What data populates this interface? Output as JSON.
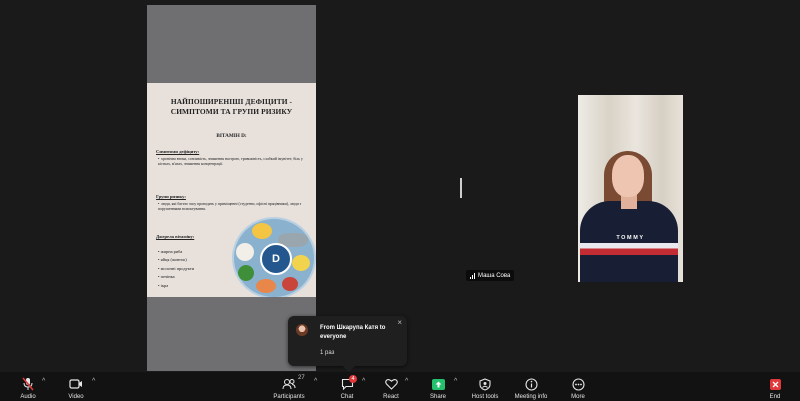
{
  "slide": {
    "title": "НАЙПОШИРЕНІШІ ДЕФІЦИТИ - СИМПТОМИ ТА ГРУПИ РИЗИКУ",
    "subtitle": "ВІТАМІН D:",
    "symptoms_heading": "Симптоми дефіциту:",
    "symptoms_text": "хронічна втома, сонливість, зниження настрою, тривожність, слабкий імунітет, біль у кістках, м'язах, зниження концентрації.",
    "risk_heading": "Групи ризику:",
    "risk_text": "люди, які багато часу проводять у приміщенні (студенти, офісні працівники), люди з порушеннями всмоктування.",
    "sources_heading": "Джерела вітаміну:",
    "sources": [
      "жирна риба",
      "яйця (жовток)",
      "молочні продукти",
      "печінка",
      "ікра"
    ],
    "plate_letter": "D"
  },
  "camera": {
    "participant_name": "Маша Сова",
    "shirt_text": "TOMMY"
  },
  "chat_toast": {
    "title": "From Шкарупа Катя to everyone",
    "message": "1 раз",
    "close": "×"
  },
  "toolbar": {
    "audio": "Audio",
    "video": "Video",
    "participants": "Participants",
    "participants_count": "27",
    "chat": "Chat",
    "chat_badge": "4",
    "react": "React",
    "share": "Share",
    "host_tools": "Host tools",
    "meeting_info": "Meeting info",
    "more": "More",
    "end": "End",
    "caret": "^"
  },
  "colors": {
    "toolbar_bg": "#121212",
    "share_green": "#23c16b",
    "end_red": "#e0383b",
    "muted_red": "#e0383b"
  }
}
